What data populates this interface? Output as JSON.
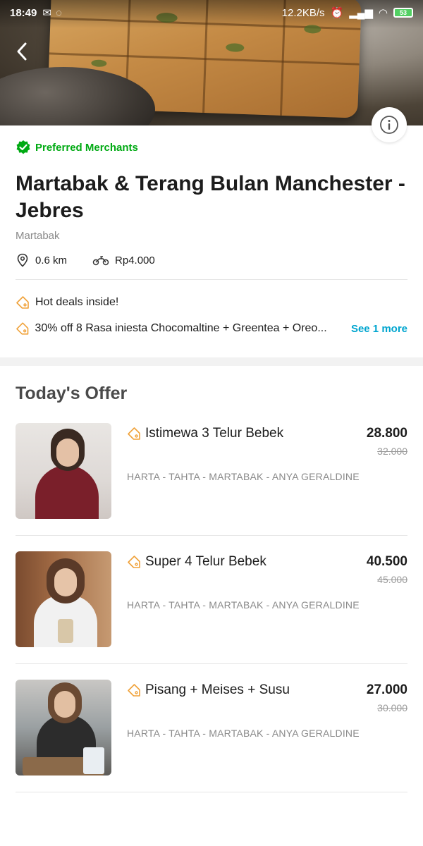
{
  "status_bar": {
    "time": "18:49",
    "network_speed": "12.2KB/s",
    "battery": "53"
  },
  "merchant": {
    "badge": "Preferred Merchants",
    "name": "Martabak & Terang Bulan Manchester - Jebres",
    "category": "Martabak",
    "distance": "0.6 km",
    "delivery_fee": "Rp4.000"
  },
  "deals": {
    "hot": "Hot deals inside!",
    "promo": "30% off 8 Rasa iniesta Chocomaltine + Greentea + Oreo...",
    "see_more": "See 1 more"
  },
  "offers": {
    "title": "Today's Offer",
    "items": [
      {
        "name": "Istimewa 3 Telur Bebek",
        "price": "28.800",
        "old_price": "32.000",
        "desc": "HARTA - TAHTA - MARTABAK - ANYA GERALDINE"
      },
      {
        "name": "Super 4 Telur Bebek",
        "price": "40.500",
        "old_price": "45.000",
        "desc": "HARTA - TAHTA - MARTABAK - ANYA GERALDINE"
      },
      {
        "name": "Pisang + Meises + Susu",
        "price": "27.000",
        "old_price": "30.000",
        "desc": "HARTA - TAHTA - MARTABAK - ANYA GERALDINE"
      }
    ]
  },
  "colors": {
    "green": "#00aa13",
    "link": "#00a5cf",
    "tag": "#f0a23a"
  },
  "icons": [
    "back-arrow-icon",
    "info-icon",
    "verified-check-icon",
    "location-pin-icon",
    "motorbike-icon",
    "tag-icon"
  ]
}
